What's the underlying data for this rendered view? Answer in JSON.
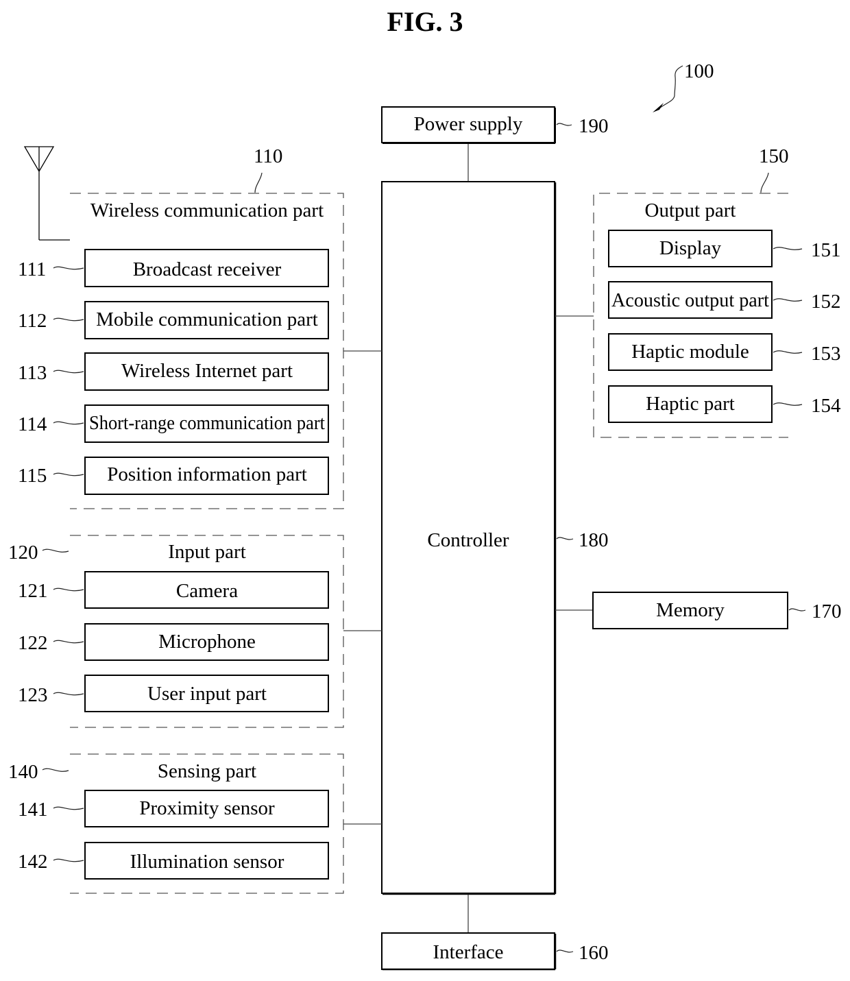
{
  "figure": {
    "title": "FIG. 3",
    "device_ref": "100"
  },
  "power_supply": {
    "label": "Power supply",
    "ref": "190"
  },
  "controller": {
    "label": "Controller",
    "ref": "180"
  },
  "interface": {
    "label": "Interface",
    "ref": "160"
  },
  "memory": {
    "label": "Memory",
    "ref": "170"
  },
  "wireless": {
    "label": "Wireless communication part",
    "ref": "110",
    "items": [
      {
        "label": "Broadcast receiver",
        "ref": "111"
      },
      {
        "label": "Mobile communication part",
        "ref": "112"
      },
      {
        "label": "Wireless Internet part",
        "ref": "113"
      },
      {
        "label": "Short-range communication part",
        "ref": "114"
      },
      {
        "label": "Position information part",
        "ref": "115"
      }
    ]
  },
  "input": {
    "label": "Input part",
    "ref": "120",
    "items": [
      {
        "label": "Camera",
        "ref": "121"
      },
      {
        "label": "Microphone",
        "ref": "122"
      },
      {
        "label": "User input part",
        "ref": "123"
      }
    ]
  },
  "sensing": {
    "label": "Sensing part",
    "ref": "140",
    "items": [
      {
        "label": "Proximity sensor",
        "ref": "141"
      },
      {
        "label": "Illumination sensor",
        "ref": "142"
      }
    ]
  },
  "output": {
    "label": "Output part",
    "ref": "150",
    "items": [
      {
        "label": "Display",
        "ref": "151"
      },
      {
        "label": "Acoustic output part",
        "ref": "152"
      },
      {
        "label": "Haptic module",
        "ref": "153"
      },
      {
        "label": "Haptic part",
        "ref": "154"
      }
    ]
  }
}
